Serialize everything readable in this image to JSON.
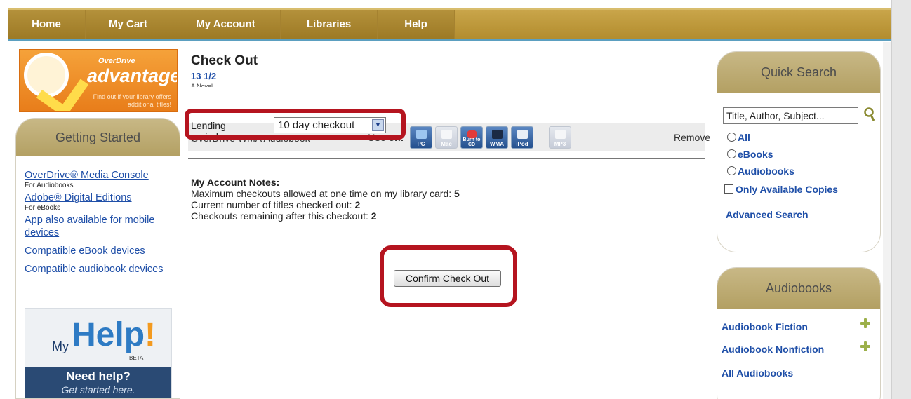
{
  "nav": {
    "items": [
      "Home",
      "My Cart",
      "My Account",
      "Libraries",
      "Help"
    ]
  },
  "logo": {
    "small": "OverDrive",
    "big": "advantage",
    "tagline": "Find out if your library offers additional titles!"
  },
  "getting_started": {
    "title": "Getting Started",
    "links": [
      {
        "label": "OverDrive® Media Console",
        "sub": "For Audiobooks"
      },
      {
        "label": "Adobe® Digital Editions",
        "sub": "For eBooks"
      },
      {
        "label": "App also available for mobile devices",
        "sub": ""
      },
      {
        "label": "Compatible eBook devices",
        "sub": ""
      },
      {
        "label": "Compatible audiobook devices",
        "sub": ""
      }
    ],
    "myhelp": {
      "my": "My",
      "help": "Help",
      "beta": "BETA",
      "need": "Need help?",
      "started": "Get started here."
    }
  },
  "main": {
    "title": "Check Out",
    "book_title": "13 1/2",
    "book_subtitle": "A Novel",
    "lending_label": "Lending period:",
    "lending_value": "10 day checkout",
    "format_name": "OverDrive WMA Audiobook",
    "use_on": "Use on:",
    "devices": [
      {
        "name": "PC",
        "enabled": true
      },
      {
        "name": "Mac",
        "enabled": false
      },
      {
        "name": "Burn to CD",
        "enabled": true
      },
      {
        "name": "WMA",
        "enabled": true
      },
      {
        "name": "iPod",
        "enabled": true
      },
      {
        "name": "MP3",
        "enabled": false
      }
    ],
    "remove": "Remove",
    "notes": {
      "heading": "My Account Notes:",
      "max_label": "Maximum checkouts allowed at one time on my library card: ",
      "max_value": "5",
      "current_label": "Current number of titles checked out: ",
      "current_value": "2",
      "remaining_label": "Checkouts remaining after this checkout: ",
      "remaining_value": "2"
    },
    "confirm_button": "Confirm Check Out"
  },
  "quick_search": {
    "title": "Quick Search",
    "placeholder": "Title, Author, Subject...",
    "options": [
      "All",
      "eBooks",
      "Audiobooks"
    ],
    "only_available": "Only Available Copies",
    "advanced": "Advanced Search"
  },
  "audiobooks": {
    "title": "Audiobooks",
    "links": [
      "Audiobook Fiction",
      "Audiobook Nonfiction",
      "All Audiobooks"
    ]
  },
  "colors": {
    "nav_gold": "#b38d2e",
    "link_blue": "#1f4fa8",
    "highlight_red": "#b5141f",
    "panel_header": "#c8b886"
  }
}
